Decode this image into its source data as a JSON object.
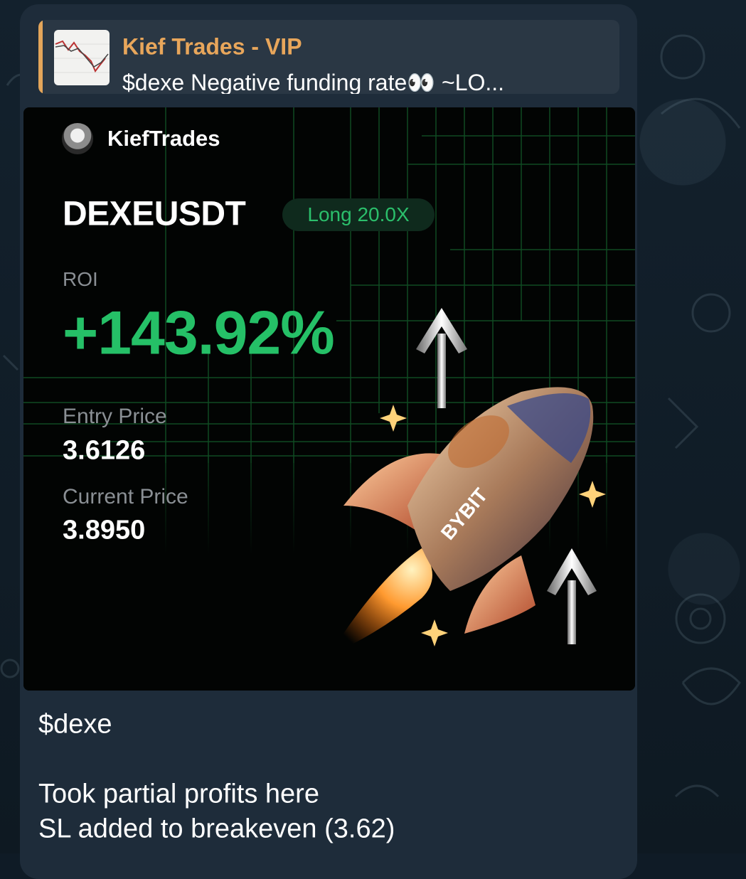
{
  "reply": {
    "author": "Kief Trades - VIP",
    "snippet": "$dexe  Negative funding rate👀  ~LO..."
  },
  "card": {
    "brand": "KiefTrades",
    "pair": "DEXEUSDT",
    "position_badge": "Long 20.0X",
    "roi_label": "ROI",
    "roi_value": "+143.92%",
    "entry_label": "Entry Price",
    "entry_value": "3.6126",
    "current_label": "Current Price",
    "current_value": "3.8950",
    "rocket_logo_text": "BYBIT"
  },
  "message": {
    "line1": "$dexe",
    "line2": "Took partial profits here",
    "line3": "SL added to breakeven (3.62)"
  },
  "colors": {
    "accent_reply": "#e3a55a",
    "roi_green": "#25c067",
    "bubble": "#1e2c3a"
  }
}
